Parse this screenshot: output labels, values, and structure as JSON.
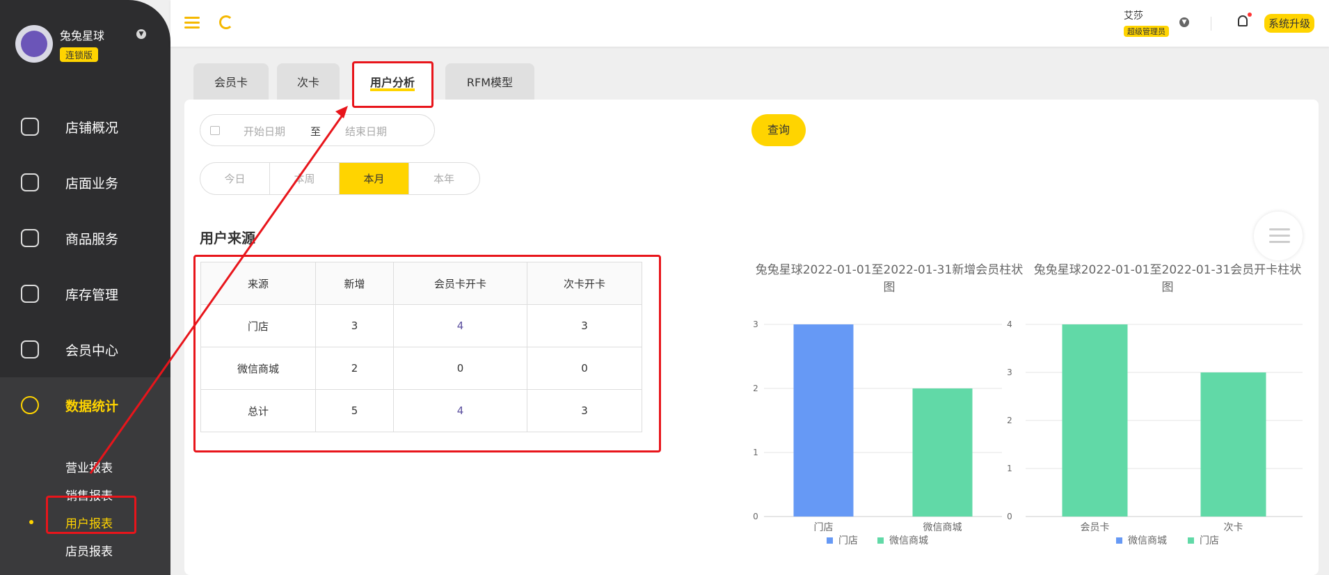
{
  "sidebar": {
    "brand_name": "兔兔星球",
    "brand_badge": "连锁版",
    "menu": [
      {
        "label": "店铺概况",
        "icon": "monitor-icon"
      },
      {
        "label": "店面业务",
        "icon": "store-icon"
      },
      {
        "label": "商品服务",
        "icon": "bag-icon"
      },
      {
        "label": "库存管理",
        "icon": "box-icon"
      },
      {
        "label": "会员中心",
        "icon": "member-icon"
      },
      {
        "label": "数据统计",
        "icon": "chart-icon",
        "active": true
      }
    ],
    "submenu": [
      {
        "label": "营业报表"
      },
      {
        "label": "销售报表"
      },
      {
        "label": "用户报表",
        "active": true
      },
      {
        "label": "店员报表"
      }
    ]
  },
  "header": {
    "user_name": "艾莎",
    "user_role": "超级管理员",
    "upgrade_label": "系统升级"
  },
  "tabs": [
    {
      "label": "会员卡"
    },
    {
      "label": "次卡"
    },
    {
      "label": "用户分析",
      "active": true
    },
    {
      "label": "RFM模型"
    }
  ],
  "filters": {
    "start_placeholder": "开始日期",
    "separator": "至",
    "end_placeholder": "结束日期",
    "query_label": "查询",
    "periods": [
      "今日",
      "本周",
      "本月",
      "本年"
    ],
    "active_period": "本月"
  },
  "section_title": "用户来源",
  "table": {
    "headers": [
      "来源",
      "新增",
      "会员卡开卡",
      "次卡开卡"
    ],
    "rows": [
      [
        "门店",
        "3",
        "4",
        "3"
      ],
      [
        "微信商城",
        "2",
        "0",
        "0"
      ],
      [
        "总计",
        "5",
        "4",
        "3"
      ]
    ]
  },
  "chart_data": [
    {
      "type": "bar",
      "title": "兔兔星球2022-01-01至2022-01-31新增会员柱状图",
      "categories": [
        "门店",
        "微信商城"
      ],
      "values": [
        3,
        2
      ],
      "colors": [
        "#6699f5",
        "#61d9a7"
      ],
      "legend": [
        "门店",
        "微信商城"
      ],
      "legend_colors": [
        "#6699f5",
        "#61d9a7"
      ],
      "ylim": [
        0,
        3
      ],
      "yticks": [
        0,
        1,
        2,
        3
      ],
      "legend_position": "bottom",
      "grid": true
    },
    {
      "type": "bar",
      "title": "兔兔星球2022-01-01至2022-01-31会员开卡柱状图",
      "categories": [
        "会员卡",
        "次卡"
      ],
      "values": [
        4,
        3
      ],
      "colors": [
        "#61d9a7",
        "#61d9a7"
      ],
      "legend": [
        "微信商城",
        "门店"
      ],
      "legend_colors": [
        "#6699f5",
        "#61d9a7"
      ],
      "ylim": [
        0,
        4
      ],
      "yticks": [
        0,
        1,
        2,
        3,
        4
      ],
      "legend_position": "bottom",
      "grid": true
    }
  ]
}
